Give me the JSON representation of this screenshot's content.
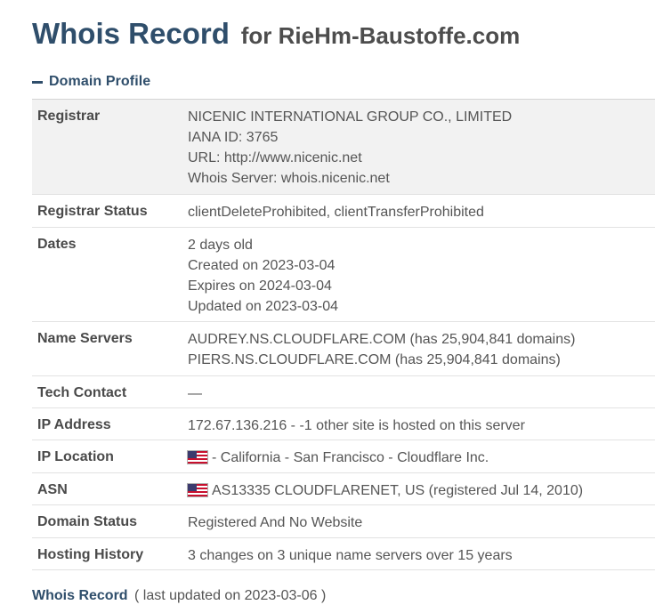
{
  "header": {
    "title": "Whois Record",
    "subtitle": "for RieHm-Baustoffe.com"
  },
  "section": {
    "label": "Domain Profile",
    "toggle_icon": "minus-icon"
  },
  "rows": [
    {
      "label": "Registrar",
      "lines": [
        "NICENIC INTERNATIONAL GROUP CO., LIMITED",
        "IANA ID: 3765",
        "URL: http://www.nicenic.net",
        "Whois Server: whois.nicenic.net"
      ]
    },
    {
      "label": "Registrar Status",
      "lines": [
        "clientDeleteProhibited, clientTransferProhibited"
      ]
    },
    {
      "label": "Dates",
      "lines": [
        "2 days old",
        "Created on 2023-03-04",
        "Expires on 2024-03-04",
        "Updated on 2023-03-04"
      ]
    },
    {
      "label": "Name Servers",
      "lines": [
        "AUDREY.NS.CLOUDFLARE.COM (has 25,904,841 domains)",
        "PIERS.NS.CLOUDFLARE.COM (has 25,904,841 domains)"
      ]
    },
    {
      "label": "Tech Contact",
      "lines": [
        "—"
      ]
    },
    {
      "label": "IP Address",
      "lines": [
        "172.67.136.216 - -1 other site is hosted on this server"
      ]
    },
    {
      "label": "IP Location",
      "lines": [
        "- California - San Francisco - Cloudflare Inc."
      ],
      "icon": "us-flag-icon"
    },
    {
      "label": "ASN",
      "lines": [
        "AS13335 CLOUDFLARENET, US (registered Jul 14, 2010)"
      ],
      "icon": "us-flag-icon"
    },
    {
      "label": "Domain Status",
      "lines": [
        "Registered And No Website"
      ]
    },
    {
      "label": "Hosting History",
      "lines": [
        "3 changes on 3 unique name servers over 15 years"
      ]
    }
  ],
  "footer": {
    "link_label": "Whois Record",
    "note": "( last updated on 2023-03-06 )"
  },
  "colors": {
    "heading": "#2f4e6b",
    "shaded_row": "#f2f2f2",
    "text": "#555555"
  }
}
